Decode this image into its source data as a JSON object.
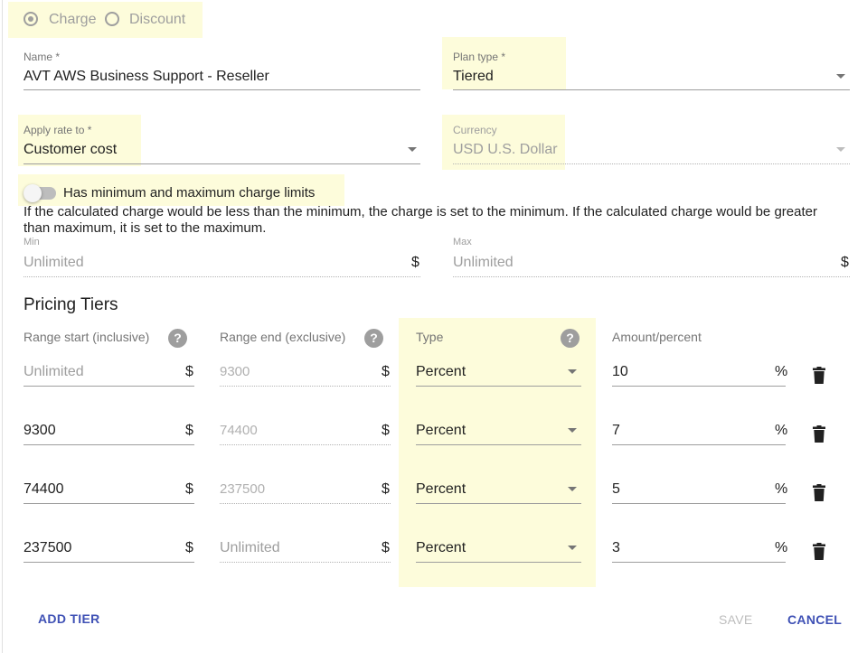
{
  "type_toggle": {
    "charge_label": "Charge",
    "discount_label": "Discount",
    "selected": "Charge"
  },
  "name_field": {
    "label": "Name *",
    "value": "AVT AWS Business Support - Reseller"
  },
  "plan_type": {
    "label": "Plan type *",
    "value": "Tiered"
  },
  "apply_rate": {
    "label": "Apply rate to *",
    "value": "Customer cost"
  },
  "currency": {
    "label": "Currency",
    "value": "USD U.S. Dollar"
  },
  "limits": {
    "toggle_label": "Has minimum and maximum charge limits",
    "enabled": false,
    "description": "If the calculated charge would be less than the minimum, the charge is set to the minimum. If the calculated charge would be greater than maximum, it is set to the maximum.",
    "min_label": "Min",
    "min_placeholder": "Unlimited",
    "min_suffix": "$",
    "max_label": "Max",
    "max_placeholder": "Unlimited",
    "max_suffix": "$"
  },
  "tiers": {
    "title": "Pricing Tiers",
    "headers": {
      "range_start": "Range start (inclusive)",
      "range_end": "Range end (exclusive)",
      "type": "Type",
      "amount": "Amount/percent",
      "help": "?"
    },
    "rows": [
      {
        "start": "Unlimited",
        "start_suffix": "$",
        "end": "9300",
        "end_suffix": "$",
        "type": "Percent",
        "amount": "10",
        "amount_suffix": "%"
      },
      {
        "start": "9300",
        "start_suffix": "$",
        "end": "74400",
        "end_suffix": "$",
        "type": "Percent",
        "amount": "7",
        "amount_suffix": "%"
      },
      {
        "start": "74400",
        "start_suffix": "$",
        "end": "237500",
        "end_suffix": "$",
        "type": "Percent",
        "amount": "5",
        "amount_suffix": "%"
      },
      {
        "start": "237500",
        "start_suffix": "$",
        "end": "Unlimited",
        "end_suffix": "$",
        "type": "Percent",
        "amount": "3",
        "amount_suffix": "%"
      }
    ]
  },
  "actions": {
    "add_tier": "ADD TIER",
    "save": "SAVE",
    "cancel": "CANCEL"
  },
  "colors": {
    "highlight": "#fdfcdb",
    "accent": "#3f51b5",
    "disabled": "#bdbdbd"
  },
  "icons": {
    "delete": "trash-icon",
    "help": "help-circle-icon",
    "dropdown": "caret-down-icon"
  }
}
